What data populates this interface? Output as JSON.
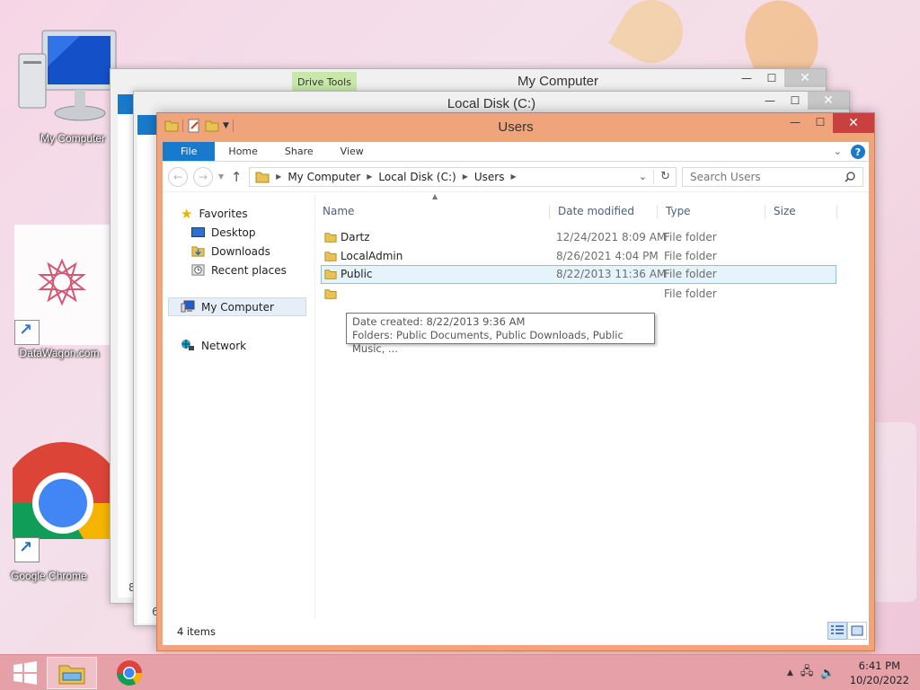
{
  "desktop": {
    "icons": [
      {
        "label": "My Computer"
      },
      {
        "label": "DataWagon.com"
      },
      {
        "label": "Google Chrome"
      }
    ]
  },
  "windows": {
    "back1": {
      "title": "My Computer",
      "context_tab": "Drive Tools"
    },
    "back2": {
      "title": "Local Disk (C:)"
    },
    "back1_edge": "8",
    "back2_edge": "6"
  },
  "main": {
    "title": "Users",
    "ribbon": {
      "tabs": [
        "File",
        "Home",
        "Share",
        "View"
      ]
    },
    "address": {
      "crumbs": [
        "My Computer",
        "Local Disk (C:)",
        "Users"
      ]
    },
    "search": {
      "placeholder": "Search Users"
    },
    "nav": {
      "favorites": "Favorites",
      "favorites_items": [
        "Desktop",
        "Downloads",
        "Recent places"
      ],
      "computer": "My Computer",
      "network": "Network"
    },
    "columns": {
      "name": "Name",
      "date": "Date modified",
      "type": "Type",
      "size": "Size"
    },
    "rows": [
      {
        "name": "Dartz",
        "date": "12/24/2021 8:09 AM",
        "type": "File folder"
      },
      {
        "name": "LocalAdmin",
        "date": "8/26/2021 4:04 PM",
        "type": "File folder"
      },
      {
        "name": "Public",
        "date": "8/22/2013 11:36 AM",
        "type": "File folder",
        "selected": true
      },
      {
        "name": "",
        "date": "",
        "type": "File folder"
      }
    ],
    "tooltip": {
      "line1": "Date created: 8/22/2013 9:36 AM",
      "line2": "Folders: Public Documents, Public Downloads, Public Music, ..."
    },
    "status": {
      "items": "4 items"
    }
  },
  "taskbar": {
    "clock": {
      "time": "6:41 PM",
      "date": "10/20/2022"
    }
  },
  "colors": {
    "file_tab": "#1979ca",
    "frame": "#f0a47b",
    "close": "#c94040",
    "taskbar": "#e6a0a8"
  }
}
